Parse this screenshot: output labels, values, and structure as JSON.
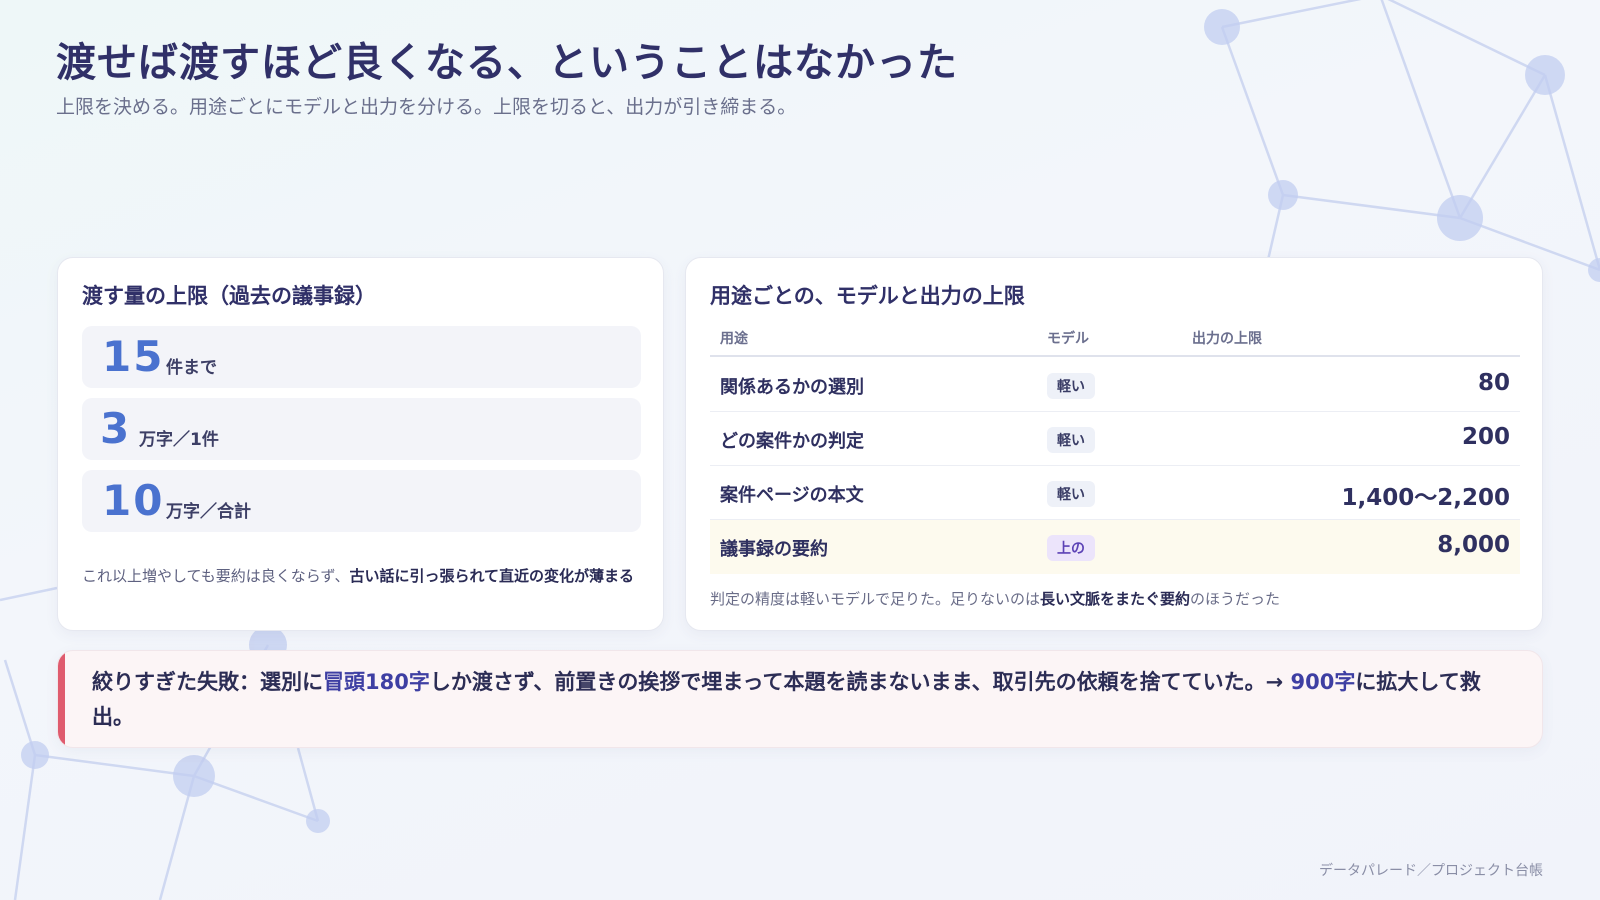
{
  "header": {
    "title": "渡せば渡すほど良くなる、ということはなかった",
    "subtitle": "上限を決める。用途ごとにモデルと出力を分ける。上限を切ると、出力が引き締まる。"
  },
  "limits_card": {
    "title": "渡す量の上限（過去の議事録）",
    "items": [
      {
        "value": "15",
        "unit": "件まで"
      },
      {
        "value": "3",
        "unit": "万字／1件"
      },
      {
        "value": "10",
        "unit": "万字／合計"
      }
    ],
    "note_prefix": "これ以上増やしても要約は良くならず、",
    "note_bold": "古い話に引っ張られて直近の変化が薄まる"
  },
  "table_card": {
    "title": "用途ごとの、モデルと出力の上限",
    "columns": [
      "用途",
      "モデル",
      "出力の上限"
    ],
    "rows": [
      {
        "use": "関係あるかの選別",
        "model": "軽い",
        "limit": "80"
      },
      {
        "use": "どの案件かの判定",
        "model": "軽い",
        "limit": "200"
      },
      {
        "use": "案件ページの本文",
        "model": "軽い",
        "limit": "1,400〜2,200"
      },
      {
        "use": "議事録の要約",
        "model": "上の",
        "limit": "8,000"
      }
    ],
    "note_prefix": "判定の精度は軽いモデルで足りた。足りないのは",
    "note_bold": "長い文脈をまたぐ要約",
    "note_suffix": "のほうだった"
  },
  "alert": {
    "lead": "絞りすぎた失敗：選別に",
    "hl1": "冒頭180字",
    "mid": "しか渡さず、前置きの挨拶で埋まって本題を読まないまま、取引先の依頼を捨てていた。→ ",
    "hl2": "900字",
    "tail": "に拡大して救出。"
  },
  "footer": {
    "text": "データパレード／プロジェクト台帳"
  },
  "colors": {
    "title": "#303068",
    "accent_number": "#4a72cf",
    "alert_bar": "#df5b6e",
    "highlight_row": "#fdfaee",
    "upper_badge": "#ece4fb"
  }
}
